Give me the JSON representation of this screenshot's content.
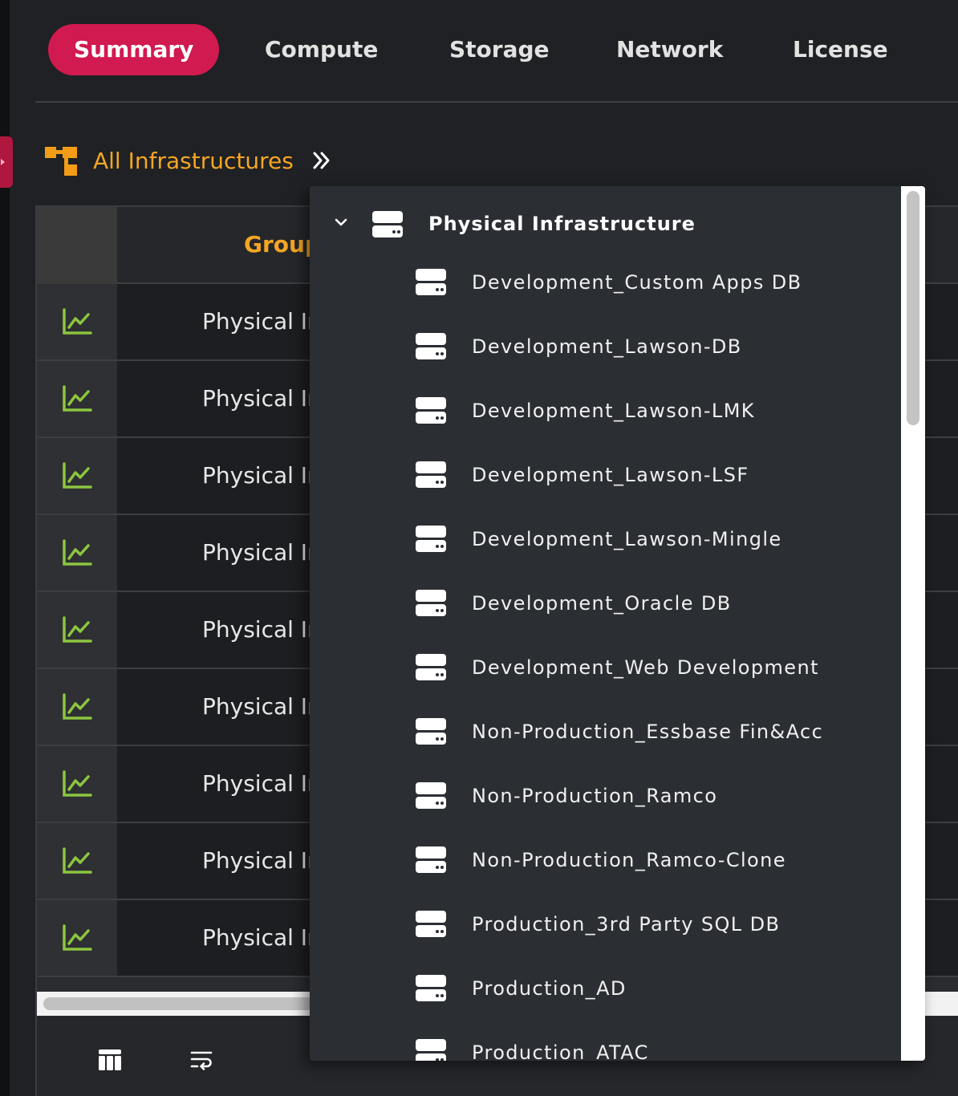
{
  "tabs": [
    {
      "label": "Summary",
      "active": true
    },
    {
      "label": "Compute",
      "active": false
    },
    {
      "label": "Storage",
      "active": false
    },
    {
      "label": "Network",
      "active": false
    },
    {
      "label": "License",
      "active": false
    }
  ],
  "breadcrumb": {
    "icon": "hierarchy-icon",
    "label": "All Infrastructures",
    "chevron": "double-chevron-right-icon"
  },
  "grid": {
    "header": {
      "group_label": "Group"
    },
    "row_icon": "line-chart-icon",
    "rows": [
      "Physical In",
      "Physical In",
      "Physical In",
      "Physical In",
      "Physical In",
      "Physical In",
      "Physical In",
      "Physical In",
      "Physical In"
    ],
    "footer_icons": [
      "columns-icon",
      "wrap-text-icon"
    ]
  },
  "dropdown": {
    "root": {
      "label": "Physical Infrastructure",
      "expanded": true,
      "icon": "server-icon"
    },
    "items": [
      "Development_Custom Apps DB",
      "Development_Lawson-DB",
      "Development_Lawson-LMK",
      "Development_Lawson-LSF",
      "Development_Lawson-Mingle",
      "Development_Oracle DB",
      "Development_Web Development",
      "Non-Production_Essbase Fin&Acc",
      "Non-Production_Ramco",
      "Non-Production_Ramco-Clone",
      "Production_3rd Party SQL DB",
      "Production_AD",
      "Production_ATAC"
    ]
  },
  "colors": {
    "accent_tab": "#d11a4f",
    "breadcrumb": "#f5a623",
    "chart_icon": "#8cc63f"
  }
}
